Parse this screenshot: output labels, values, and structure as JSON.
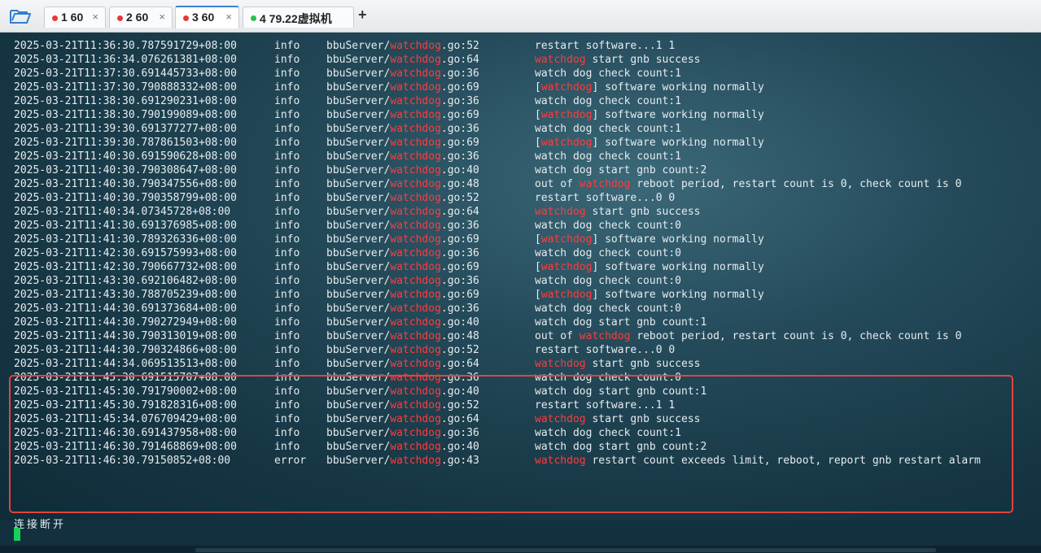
{
  "tabs": [
    {
      "label": "1 60",
      "dot_color": "#e53935",
      "active": false
    },
    {
      "label": "2 60",
      "dot_color": "#e53935",
      "active": false
    },
    {
      "label": "3 60",
      "dot_color": "#e53935",
      "active": true
    },
    {
      "label": "4 79.22虚拟机",
      "dot_color": "#2ebd4f",
      "active": false
    }
  ],
  "close_glyph": "×",
  "new_tab_glyph": "+",
  "accent_color": "#ff3c3c",
  "highlight_border_color": "#e2433e",
  "log_lines": [
    {
      "ts": "2025-03-21T11:36:30.787591729+08:00",
      "lvl": "info",
      "src_pre": "bbuServer/",
      "src_hl": "watchdog",
      "src_post": ".go:52",
      "msg_pre": "restart software...1 1",
      "msg_hl": "",
      "msg_post": ""
    },
    {
      "ts": "2025-03-21T11:36:34.076261381+08:00",
      "lvl": "info",
      "src_pre": "bbuServer/",
      "src_hl": "watchdog",
      "src_post": ".go:64",
      "msg_pre": "",
      "msg_hl": "watchdog",
      "msg_post": " start gnb success"
    },
    {
      "ts": "2025-03-21T11:37:30.691445733+08:00",
      "lvl": "info",
      "src_pre": "bbuServer/",
      "src_hl": "watchdog",
      "src_post": ".go:36",
      "msg_pre": "watch dog check count:1",
      "msg_hl": "",
      "msg_post": ""
    },
    {
      "ts": "2025-03-21T11:37:30.790888332+08:00",
      "lvl": "info",
      "src_pre": "bbuServer/",
      "src_hl": "watchdog",
      "src_post": ".go:69",
      "msg_pre": "[",
      "msg_hl": "watchdog",
      "msg_post": "] software working normally"
    },
    {
      "ts": "2025-03-21T11:38:30.691290231+08:00",
      "lvl": "info",
      "src_pre": "bbuServer/",
      "src_hl": "watchdog",
      "src_post": ".go:36",
      "msg_pre": "watch dog check count:1",
      "msg_hl": "",
      "msg_post": ""
    },
    {
      "ts": "2025-03-21T11:38:30.790199089+08:00",
      "lvl": "info",
      "src_pre": "bbuServer/",
      "src_hl": "watchdog",
      "src_post": ".go:69",
      "msg_pre": "[",
      "msg_hl": "watchdog",
      "msg_post": "] software working normally"
    },
    {
      "ts": "2025-03-21T11:39:30.691377277+08:00",
      "lvl": "info",
      "src_pre": "bbuServer/",
      "src_hl": "watchdog",
      "src_post": ".go:36",
      "msg_pre": "watch dog check count:1",
      "msg_hl": "",
      "msg_post": ""
    },
    {
      "ts": "2025-03-21T11:39:30.787861503+08:00",
      "lvl": "info",
      "src_pre": "bbuServer/",
      "src_hl": "watchdog",
      "src_post": ".go:69",
      "msg_pre": "[",
      "msg_hl": "watchdog",
      "msg_post": "] software working normally"
    },
    {
      "ts": "2025-03-21T11:40:30.691590628+08:00",
      "lvl": "info",
      "src_pre": "bbuServer/",
      "src_hl": "watchdog",
      "src_post": ".go:36",
      "msg_pre": "watch dog check count:1",
      "msg_hl": "",
      "msg_post": ""
    },
    {
      "ts": "2025-03-21T11:40:30.790308647+08:00",
      "lvl": "info",
      "src_pre": "bbuServer/",
      "src_hl": "watchdog",
      "src_post": ".go:40",
      "msg_pre": "watch dog start gnb count:2",
      "msg_hl": "",
      "msg_post": ""
    },
    {
      "ts": "2025-03-21T11:40:30.790347556+08:00",
      "lvl": "info",
      "src_pre": "bbuServer/",
      "src_hl": "watchdog",
      "src_post": ".go:48",
      "msg_pre": "out of ",
      "msg_hl": "watchdog",
      "msg_post": " reboot period, restart count is 0, check count is 0"
    },
    {
      "ts": "2025-03-21T11:40:30.790358799+08:00",
      "lvl": "info",
      "src_pre": "bbuServer/",
      "src_hl": "watchdog",
      "src_post": ".go:52",
      "msg_pre": "restart software...0 0",
      "msg_hl": "",
      "msg_post": ""
    },
    {
      "ts": "2025-03-21T11:40:34.07345728+08:00",
      "lvl": "info",
      "src_pre": "bbuServer/",
      "src_hl": "watchdog",
      "src_post": ".go:64",
      "msg_pre": "",
      "msg_hl": "watchdog",
      "msg_post": " start gnb success"
    },
    {
      "ts": "2025-03-21T11:41:30.691376985+08:00",
      "lvl": "info",
      "src_pre": "bbuServer/",
      "src_hl": "watchdog",
      "src_post": ".go:36",
      "msg_pre": "watch dog check count:0",
      "msg_hl": "",
      "msg_post": ""
    },
    {
      "ts": "2025-03-21T11:41:30.789326336+08:00",
      "lvl": "info",
      "src_pre": "bbuServer/",
      "src_hl": "watchdog",
      "src_post": ".go:69",
      "msg_pre": "[",
      "msg_hl": "watchdog",
      "msg_post": "] software working normally"
    },
    {
      "ts": "2025-03-21T11:42:30.691575993+08:00",
      "lvl": "info",
      "src_pre": "bbuServer/",
      "src_hl": "watchdog",
      "src_post": ".go:36",
      "msg_pre": "watch dog check count:0",
      "msg_hl": "",
      "msg_post": ""
    },
    {
      "ts": "2025-03-21T11:42:30.790667732+08:00",
      "lvl": "info",
      "src_pre": "bbuServer/",
      "src_hl": "watchdog",
      "src_post": ".go:69",
      "msg_pre": "[",
      "msg_hl": "watchdog",
      "msg_post": "] software working normally"
    },
    {
      "ts": "2025-03-21T11:43:30.692106482+08:00",
      "lvl": "info",
      "src_pre": "bbuServer/",
      "src_hl": "watchdog",
      "src_post": ".go:36",
      "msg_pre": "watch dog check count:0",
      "msg_hl": "",
      "msg_post": ""
    },
    {
      "ts": "2025-03-21T11:43:30.788705239+08:00",
      "lvl": "info",
      "src_pre": "bbuServer/",
      "src_hl": "watchdog",
      "src_post": ".go:69",
      "msg_pre": "[",
      "msg_hl": "watchdog",
      "msg_post": "] software working normally"
    },
    {
      "ts": "2025-03-21T11:44:30.691373684+08:00",
      "lvl": "info",
      "src_pre": "bbuServer/",
      "src_hl": "watchdog",
      "src_post": ".go:36",
      "msg_pre": "watch dog check count:0",
      "msg_hl": "",
      "msg_post": ""
    },
    {
      "ts": "2025-03-21T11:44:30.790272949+08:00",
      "lvl": "info",
      "src_pre": "bbuServer/",
      "src_hl": "watchdog",
      "src_post": ".go:40",
      "msg_pre": "watch dog start gnb count:1",
      "msg_hl": "",
      "msg_post": ""
    },
    {
      "ts": "2025-03-21T11:44:30.790313019+08:00",
      "lvl": "info",
      "src_pre": "bbuServer/",
      "src_hl": "watchdog",
      "src_post": ".go:48",
      "msg_pre": "out of ",
      "msg_hl": "watchdog",
      "msg_post": " reboot period, restart count is 0, check count is 0"
    },
    {
      "ts": "2025-03-21T11:44:30.790324866+08:00",
      "lvl": "info",
      "src_pre": "bbuServer/",
      "src_hl": "watchdog",
      "src_post": ".go:52",
      "msg_pre": "restart software...0 0",
      "msg_hl": "",
      "msg_post": ""
    },
    {
      "ts": "2025-03-21T11:44:34.069513513+08:00",
      "lvl": "info",
      "src_pre": "bbuServer/",
      "src_hl": "watchdog",
      "src_post": ".go:64",
      "msg_pre": "",
      "msg_hl": "watchdog",
      "msg_post": " start gnb success"
    },
    {
      "ts": "2025-03-21T11:45:30.691515707+08:00",
      "lvl": "info",
      "src_pre": "bbuServer/",
      "src_hl": "watchdog",
      "src_post": ".go:36",
      "msg_pre": "watch dog check count:0",
      "msg_hl": "",
      "msg_post": ""
    },
    {
      "ts": "2025-03-21T11:45:30.791790002+08:00",
      "lvl": "info",
      "src_pre": "bbuServer/",
      "src_hl": "watchdog",
      "src_post": ".go:40",
      "msg_pre": "watch dog start gnb count:1",
      "msg_hl": "",
      "msg_post": ""
    },
    {
      "ts": "2025-03-21T11:45:30.79182831б+08:00",
      "lvl": "info",
      "src_pre": "bbuServer/",
      "src_hl": "watchdog",
      "src_post": ".go:52",
      "msg_pre": "restart software...1 1",
      "msg_hl": "",
      "msg_post": ""
    },
    {
      "ts": "2025-03-21T11:45:34.076709429+08:00",
      "lvl": "info",
      "src_pre": "bbuServer/",
      "src_hl": "watchdog",
      "src_post": ".go:64",
      "msg_pre": "",
      "msg_hl": "watchdog",
      "msg_post": " start gnb success"
    },
    {
      "ts": "2025-03-21T11:46:30.691437958+08:00",
      "lvl": "info",
      "src_pre": "bbuServer/",
      "src_hl": "watchdog",
      "src_post": ".go:36",
      "msg_pre": "watch dog check count:1",
      "msg_hl": "",
      "msg_post": ""
    },
    {
      "ts": "2025-03-21T11:46:30.791468869+08:00",
      "lvl": "info",
      "src_pre": "bbuServer/",
      "src_hl": "watchdog",
      "src_post": ".go:40",
      "msg_pre": "watch dog start gnb count:2",
      "msg_hl": "",
      "msg_post": ""
    },
    {
      "ts": "2025-03-21T11:46:30.79150852+08:00",
      "lvl": "error",
      "src_pre": "bbuServer/",
      "src_hl": "watchdog",
      "src_post": ".go:43",
      "msg_pre": "",
      "msg_hl": "watchdog",
      "msg_post": " restart count exceeds limit, reboot, report gnb restart alarm"
    }
  ],
  "disconnect_text": "连接断开"
}
